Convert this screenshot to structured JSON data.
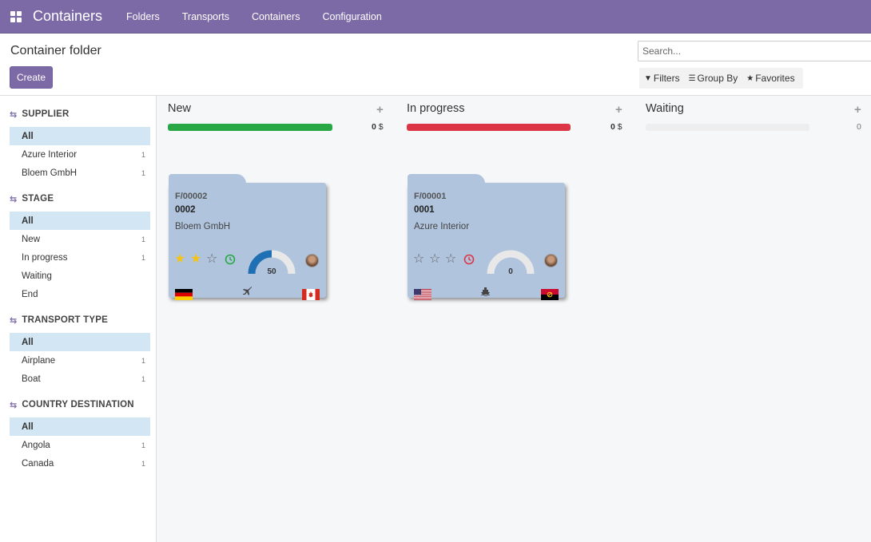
{
  "navbar": {
    "brand": "Containers",
    "menu": [
      "Folders",
      "Transports",
      "Containers",
      "Configuration"
    ]
  },
  "control": {
    "title": "Container folder",
    "create_label": "Create",
    "search_placeholder": "Search...",
    "filters_label": "Filters",
    "groupby_label": "Group By",
    "favorites_label": "Favorites"
  },
  "sidebar": {
    "sections": [
      {
        "title": "SUPPLIER",
        "items": [
          {
            "label": "All",
            "count": ""
          },
          {
            "label": "Azure Interior",
            "count": "1"
          },
          {
            "label": "Bloem GmbH",
            "count": "1"
          }
        ]
      },
      {
        "title": "STAGE",
        "items": [
          {
            "label": "All",
            "count": ""
          },
          {
            "label": "New",
            "count": "1"
          },
          {
            "label": "In progress",
            "count": "1"
          },
          {
            "label": "Waiting",
            "count": ""
          },
          {
            "label": "End",
            "count": ""
          }
        ]
      },
      {
        "title": "TRANSPORT TYPE",
        "items": [
          {
            "label": "All",
            "count": ""
          },
          {
            "label": "Airplane",
            "count": "1"
          },
          {
            "label": "Boat",
            "count": "1"
          }
        ]
      },
      {
        "title": "COUNTRY DESTINATION",
        "items": [
          {
            "label": "All",
            "count": ""
          },
          {
            "label": "Angola",
            "count": "1"
          },
          {
            "label": "Canada",
            "count": "1"
          }
        ]
      }
    ]
  },
  "kanban": {
    "columns": [
      {
        "title": "New",
        "sum": "0",
        "currency": "$",
        "bar_color": "#28a745"
      },
      {
        "title": "In progress",
        "sum": "0",
        "currency": "$",
        "bar_color": "#dc3545"
      },
      {
        "title": "Waiting",
        "sum": "0",
        "currency": "",
        "bar_color": "#eeeeee"
      }
    ],
    "cards": [
      {
        "ref": "F/00002",
        "number": "0002",
        "partner": "Bloem GmbH",
        "stars": 2,
        "clock_color": "#28a745",
        "gauge_value": "50",
        "gauge_fraction": 0.5,
        "transport": "airplane-icon",
        "origin_flag": "germany",
        "destination_flag": "canada"
      },
      {
        "ref": "F/00001",
        "number": "0001",
        "partner": "Azure Interior",
        "stars": 0,
        "clock_color": "#dc3545",
        "gauge_value": "0",
        "gauge_fraction": 0,
        "transport": "boat-icon",
        "origin_flag": "usa",
        "destination_flag": "angola"
      }
    ]
  },
  "colors": {
    "brand": "#7c6aa6",
    "card_bg": "#b0c4de",
    "active_filter_bg": "#d3e6f4"
  }
}
